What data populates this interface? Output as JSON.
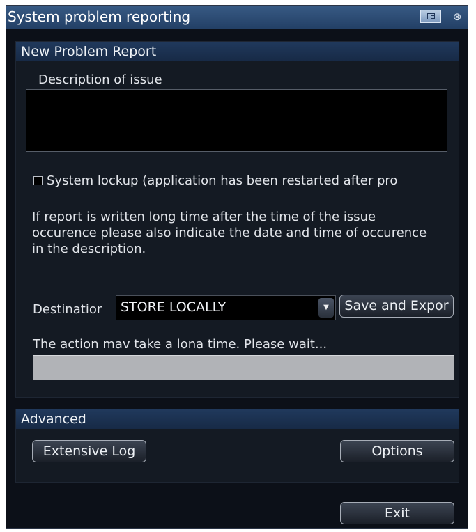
{
  "window": {
    "title": "System problem reporting",
    "restore_icon": "restore-window-icon",
    "close_icon": "close-icon",
    "close_glyph": "⊗"
  },
  "new_report": {
    "header": "New Problem Report",
    "description_label": "Description of issue",
    "description_value": "",
    "lockup_checkbox_label": "System lockup  (application has been restarted after pro",
    "lockup_checked": false,
    "info_text": "If report is written long time after the time of the issue occurence please also indicate the date and time of occurence in the description.",
    "destination_label": "Destinatior",
    "destination_value": "STORE LOCALLY",
    "save_export_label": "Save and Expor",
    "wait_text": "The action mav take a lona time. Please wait...",
    "progress": 0
  },
  "advanced": {
    "header": "Advanced",
    "extensive_log_label": "Extensive Log",
    "options_label": "Options"
  },
  "footer": {
    "exit_label": "Exit"
  },
  "colors": {
    "titlebar": "#2c4a72",
    "panel_header": "#1c3252",
    "background": "#0c1018",
    "progress_fill": "#b1b3b7"
  }
}
